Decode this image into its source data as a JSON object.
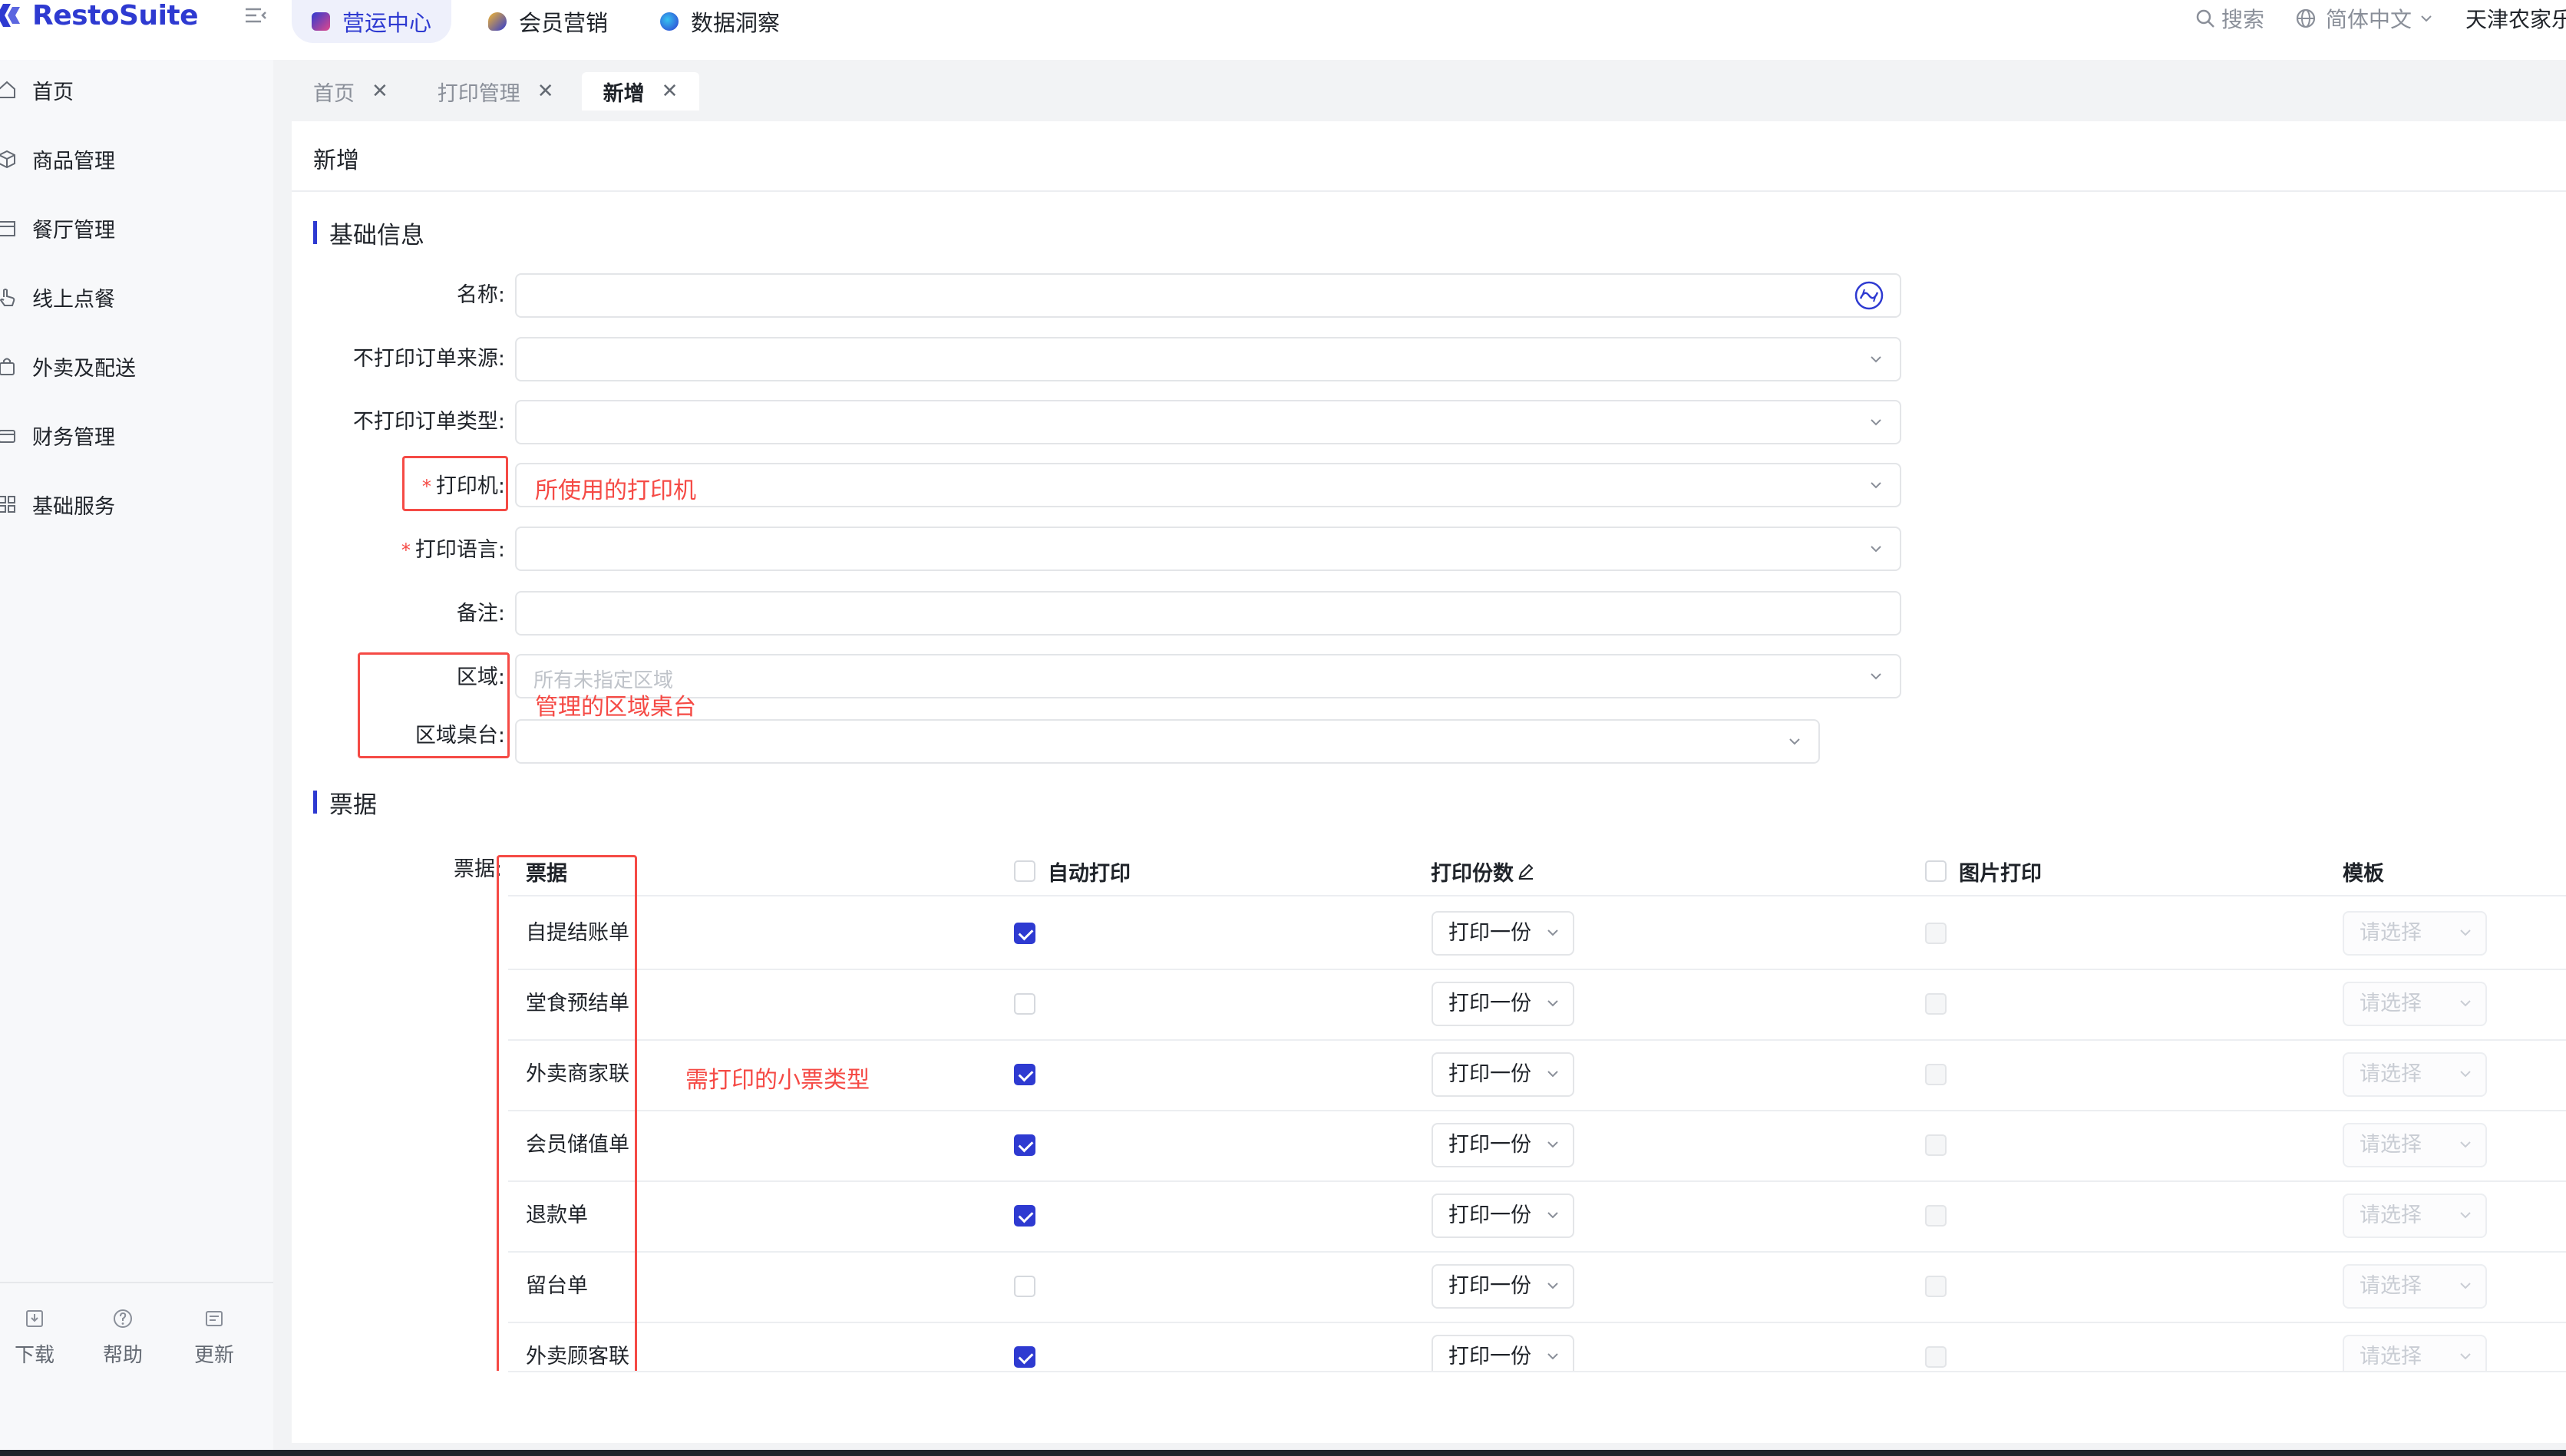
{
  "brand": {
    "name": "RestoSuite",
    "accent": "#2e3ad1"
  },
  "topnav": {
    "tabs": [
      {
        "label": "营运中心",
        "active": true,
        "icon": "operations-icon"
      },
      {
        "label": "会员营销",
        "active": false,
        "icon": "member-icon"
      },
      {
        "label": "数据洞察",
        "active": false,
        "icon": "insight-icon"
      }
    ],
    "search": "搜索",
    "language": "简体中文",
    "store": "天津农家乐"
  },
  "sidebar": {
    "items": [
      {
        "label": "首页",
        "icon": "home-icon"
      },
      {
        "label": "商品管理",
        "icon": "box-icon"
      },
      {
        "label": "餐厅管理",
        "icon": "store-icon"
      },
      {
        "label": "线上点餐",
        "icon": "touch-icon"
      },
      {
        "label": "外卖及配送",
        "icon": "bag-icon"
      },
      {
        "label": "财务管理",
        "icon": "wallet-icon"
      },
      {
        "label": "基础服务",
        "icon": "grid-icon"
      }
    ],
    "bottom": [
      {
        "label": "下载",
        "icon": "download-icon"
      },
      {
        "label": "帮助",
        "icon": "help-icon"
      },
      {
        "label": "更新",
        "icon": "update-icon"
      }
    ]
  },
  "page_tabs": [
    {
      "label": "首页",
      "active": false
    },
    {
      "label": "打印管理",
      "active": false
    },
    {
      "label": "新增",
      "active": true
    }
  ],
  "panel_title": "新增",
  "form": {
    "section_basic": "基础信息",
    "fields": {
      "name": "名称",
      "no_print_source": "不打印订单来源",
      "no_print_type": "不打印订单类型",
      "printer": "打印机",
      "language": "打印语言",
      "remark": "备注",
      "area": "区域",
      "area_placeholder": "所有未指定区域",
      "area_table": "区域桌台"
    },
    "colon": ":",
    "annotations": {
      "printer_note": "所使用的打印机",
      "area_note": "管理的区域桌台",
      "ticket_note": "需打印的小票类型"
    }
  },
  "tickets": {
    "section": "票据",
    "label": "票据",
    "columns": {
      "name": "票据",
      "auto_print": "自动打印",
      "copies": "打印份数",
      "image_print": "图片打印",
      "template": "模板"
    },
    "rows": [
      {
        "name": "自提结账单",
        "auto": true,
        "copies": "打印一份",
        "template": "请选择"
      },
      {
        "name": "堂食预结单",
        "auto": false,
        "copies": "打印一份",
        "template": "请选择"
      },
      {
        "name": "外卖商家联",
        "auto": true,
        "copies": "打印一份",
        "template": "请选择"
      },
      {
        "name": "会员储值单",
        "auto": true,
        "copies": "打印一份",
        "template": "请选择"
      },
      {
        "name": "退款单",
        "auto": true,
        "copies": "打印一份",
        "template": "请选择"
      },
      {
        "name": "留台单",
        "auto": false,
        "copies": "打印一份",
        "template": "请选择"
      },
      {
        "name": "外卖顾客联",
        "auto": true,
        "copies": "打印一份",
        "template": "请选择"
      }
    ]
  }
}
